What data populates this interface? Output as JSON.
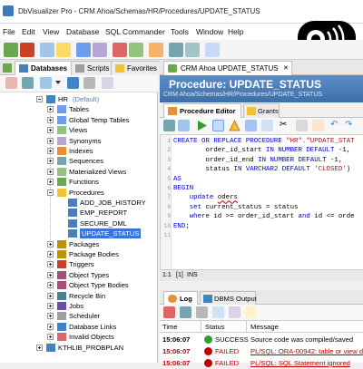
{
  "window": {
    "title": "DbVisualizer Pro - CRM Ahoa/Schemas/HR/Procedures/UPDATE_STATUS"
  },
  "menu": [
    "File",
    "Edit",
    "View",
    "Database",
    "SQL Commander",
    "Tools",
    "Window",
    "Help"
  ],
  "left_tabs": [
    "Databases",
    "Scripts",
    "Favorites"
  ],
  "tree": {
    "schema": {
      "name": "HR",
      "badge": "(Default)"
    },
    "items": [
      {
        "label": "Tables",
        "exp": "plus",
        "icon": "table"
      },
      {
        "label": "Global Temp Tables",
        "exp": "plus",
        "icon": "table"
      },
      {
        "label": "Views",
        "exp": "plus",
        "icon": "view"
      },
      {
        "label": "Synonyms",
        "exp": "plus",
        "icon": "synonym"
      },
      {
        "label": "Indexes",
        "exp": "plus",
        "icon": "index"
      },
      {
        "label": "Sequences",
        "exp": "plus",
        "icon": "sequence"
      },
      {
        "label": "Materialized Views",
        "exp": "plus",
        "icon": "view"
      },
      {
        "label": "Functions",
        "exp": "plus",
        "icon": "function"
      },
      {
        "label": "Procedures",
        "exp": "minus",
        "icon": "folder"
      }
    ],
    "procedures": [
      "ADD_JOB_HISTORY",
      "EMP_REPORT",
      "SECURE_DML",
      "UPDATE_STATUS"
    ],
    "after": [
      {
        "label": "Packages",
        "icon": "package"
      },
      {
        "label": "Package Bodies",
        "icon": "package"
      },
      {
        "label": "Triggers",
        "icon": "trigger"
      },
      {
        "label": "Object Types",
        "icon": "type"
      },
      {
        "label": "Object Type Bodies",
        "icon": "type"
      },
      {
        "label": "Recycle Bin",
        "icon": "recycle"
      },
      {
        "label": "Jobs",
        "icon": "job"
      },
      {
        "label": "Scheduler",
        "icon": "scheduler"
      },
      {
        "label": "Database Links",
        "icon": "link"
      },
      {
        "label": "Invalid Objects",
        "icon": "invalid"
      }
    ],
    "last": "KTHLIB_PROBPLAN"
  },
  "editor_tab": "CRM Ahoa UPDATE_STATUS",
  "header": {
    "title": "Procedure: UPDATE_STATUS",
    "path": "CRM Ahoa/Schemas/HR/Procedures/UPDATE_STATUS"
  },
  "subtabs": [
    "Procedure Editor",
    "Grants"
  ],
  "code_lines": [
    "1",
    "2",
    "3",
    "4",
    "5",
    "6",
    "7",
    "8",
    "9",
    "10",
    "11"
  ],
  "status_bar": {
    "pos": "1:1",
    "num": "[1]",
    "mode": "INS"
  },
  "log_tabs": [
    "Log",
    "DBMS Output"
  ],
  "log": {
    "headers": [
      "Time",
      "Status",
      "Message"
    ],
    "rows": [
      {
        "time": "15:06:07",
        "status": "SUCCESS",
        "message": "Source code was compiled/saved"
      },
      {
        "time": "15:06:07",
        "status": "FAILED",
        "message": "PL/SQL: ORA-00942: table or view does n"
      },
      {
        "time": "15:06:07",
        "status": "FAILED",
        "message": "PL/SQL: SQL Statement ignored"
      }
    ]
  },
  "colors": {
    "accent": "#3875d7",
    "header": "#4a7fbd",
    "failed": "#c00000",
    "success": "#2e9e2e"
  }
}
